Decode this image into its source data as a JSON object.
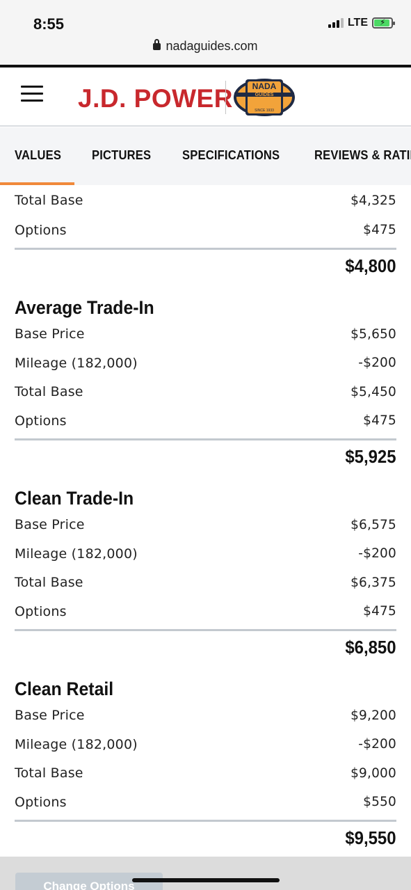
{
  "status_bar": {
    "time": "8:55",
    "network": "LTE",
    "url": "nadaguides.com"
  },
  "header": {
    "brand": "J.D. POWER",
    "nada_logo_text": "NADA",
    "nada_logo_subtext": "GUIDES",
    "nada_logo_since": "SINCE 1933",
    "brand_color": "#c8282d",
    "nada_logo_colors": [
      "#1f2a44",
      "#f2a33a"
    ]
  },
  "tabs": [
    {
      "label": "VALUES",
      "active": true
    },
    {
      "label": "PICTURES",
      "active": false
    },
    {
      "label": "SPECIFICATIONS",
      "active": false
    },
    {
      "label": "REVIEWS & RATIN",
      "active": false
    }
  ],
  "accent_color": "#f0893a",
  "top_partial": {
    "rows": [
      {
        "label": "Total Base",
        "value": "$4,325"
      },
      {
        "label": "Options",
        "value": "$475"
      }
    ],
    "total": "$4,800"
  },
  "sections": [
    {
      "title": "Average Trade-In",
      "rows": [
        {
          "label": "Base Price",
          "value": "$5,650"
        },
        {
          "label": "Mileage (182,000)",
          "value": "-$200"
        },
        {
          "label": "Total Base",
          "value": "$5,450"
        },
        {
          "label": "Options",
          "value": "$475"
        }
      ],
      "total": "$5,925"
    },
    {
      "title": "Clean Trade-In",
      "rows": [
        {
          "label": "Base Price",
          "value": "$6,575"
        },
        {
          "label": "Mileage (182,000)",
          "value": "-$200"
        },
        {
          "label": "Total Base",
          "value": "$6,375"
        },
        {
          "label": "Options",
          "value": "$475"
        }
      ],
      "total": "$6,850"
    },
    {
      "title": "Clean Retail",
      "rows": [
        {
          "label": "Base Price",
          "value": "$9,200"
        },
        {
          "label": "Mileage (182,000)",
          "value": "-$200"
        },
        {
          "label": "Total Base",
          "value": "$9,000"
        },
        {
          "label": "Options",
          "value": "$550"
        }
      ],
      "total": "$9,550"
    }
  ],
  "bottom_button": "Change Options"
}
